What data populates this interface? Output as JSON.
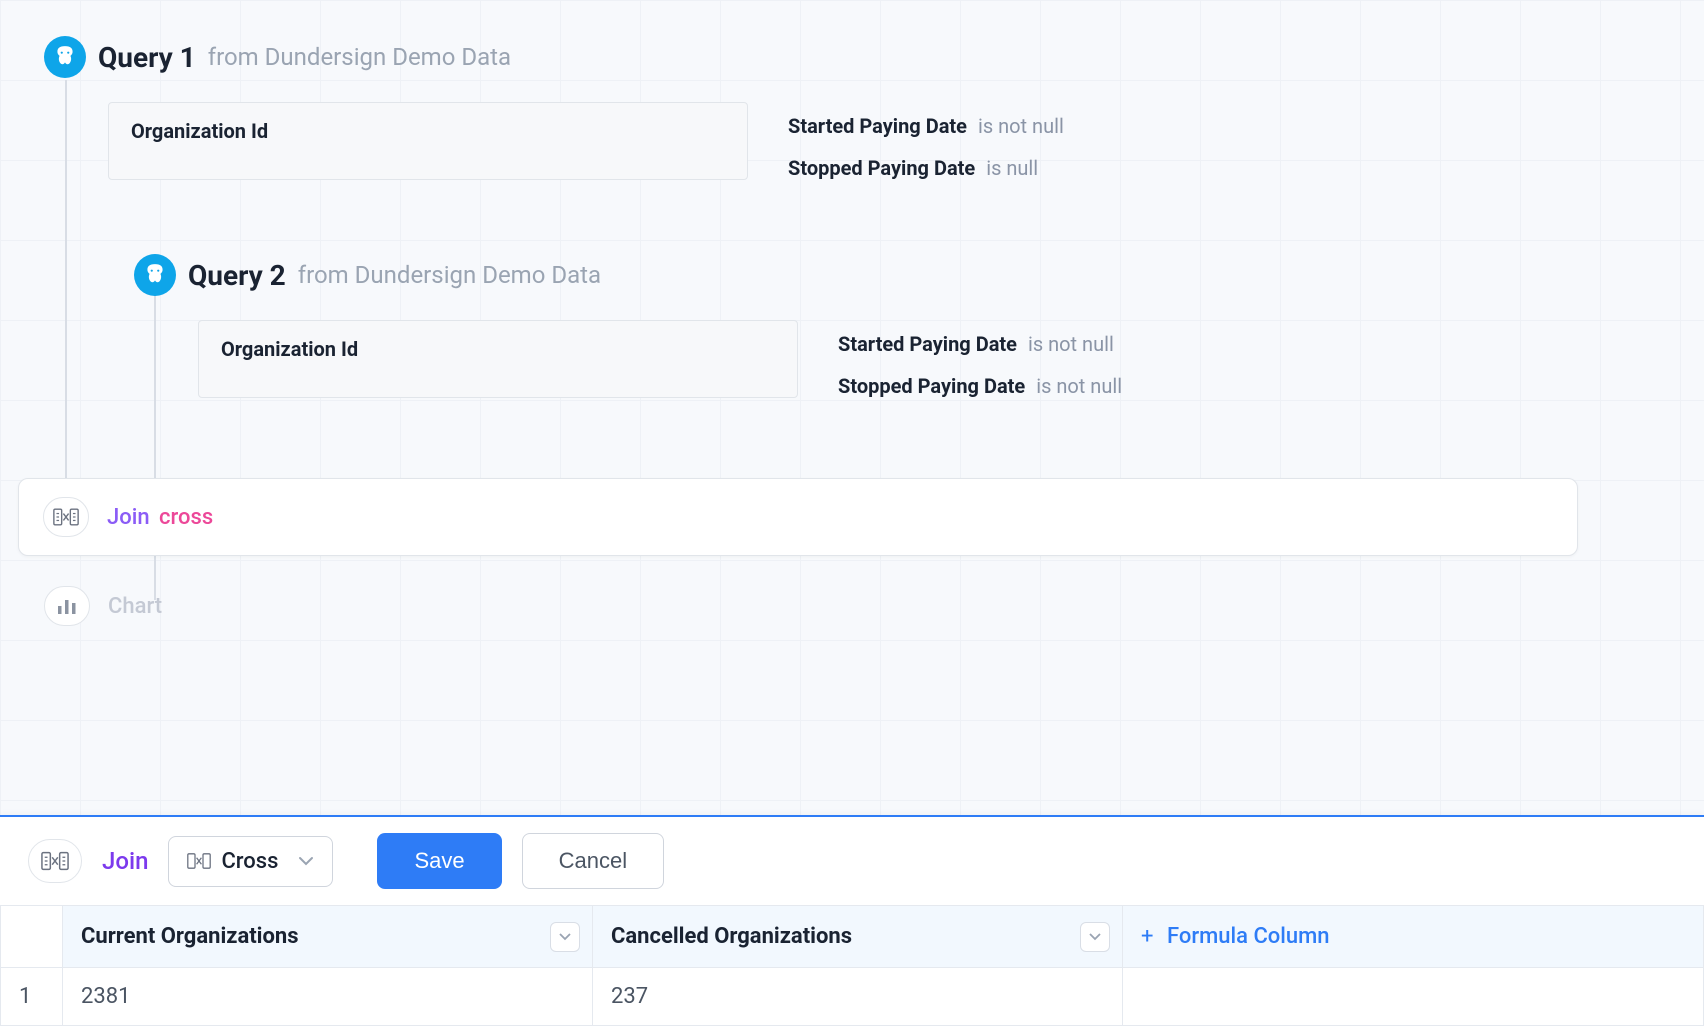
{
  "queries": [
    {
      "title": "Query 1",
      "from_prefix": "from",
      "source": "Dundersign Demo Data",
      "field": "Organization Id",
      "conditions": [
        {
          "field": "Started Paying Date",
          "op": "is not null"
        },
        {
          "field": "Stopped Paying Date",
          "op": "is null"
        }
      ]
    },
    {
      "title": "Query 2",
      "from_prefix": "from",
      "source": "Dundersign Demo Data",
      "field": "Organization Id",
      "conditions": [
        {
          "field": "Started Paying Date",
          "op": "is not null"
        },
        {
          "field": "Stopped Paying Date",
          "op": "is not null"
        }
      ]
    }
  ],
  "join_step": {
    "label": "Join",
    "type": "cross"
  },
  "chart_step": {
    "label": "Chart"
  },
  "toolbar": {
    "join_label": "Join",
    "dropdown_value": "Cross",
    "save_label": "Save",
    "cancel_label": "Cancel"
  },
  "table": {
    "columns": [
      "Current Organizations",
      "Cancelled Organizations"
    ],
    "formula_label": "Formula Column",
    "rows": [
      {
        "num": "1",
        "values": [
          "2381",
          "237"
        ]
      }
    ]
  }
}
